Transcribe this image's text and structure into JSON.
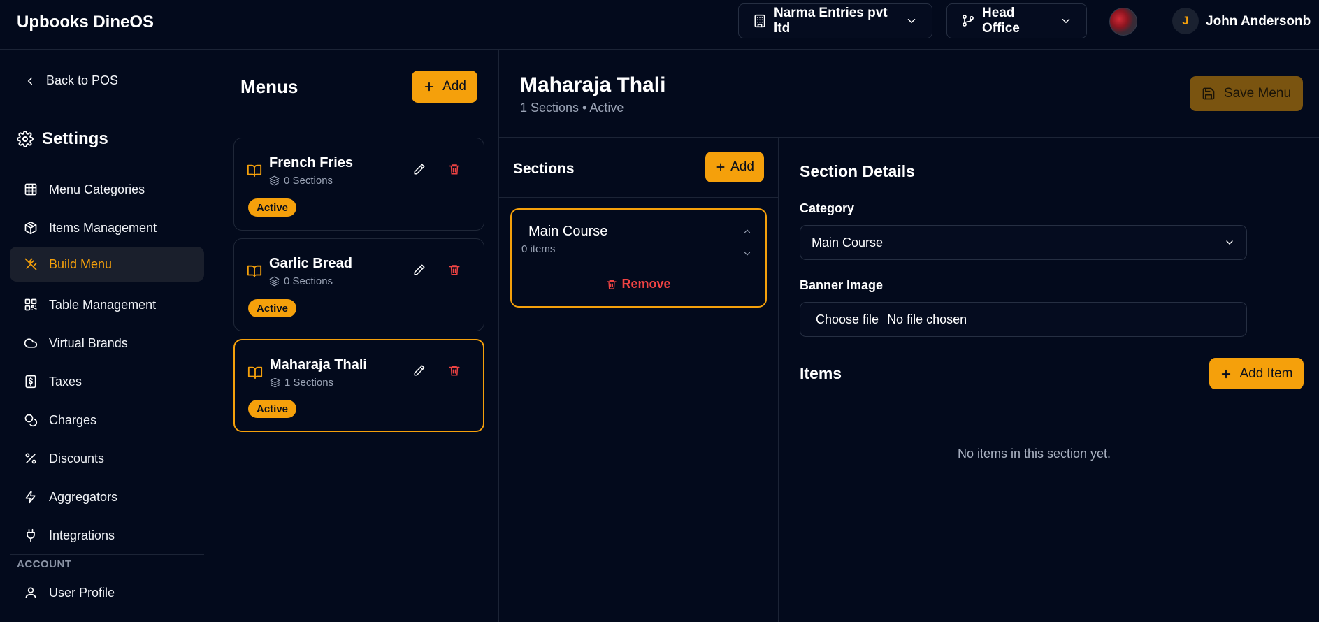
{
  "app": {
    "title": "Upbooks DineOS"
  },
  "header": {
    "org": {
      "label": "Narma Entries pvt ltd",
      "icon": "building-icon"
    },
    "branch": {
      "label": "Head Office",
      "icon": "git-branch-icon"
    },
    "user": {
      "initial": "J",
      "name": "John Andersonb"
    }
  },
  "sidebar": {
    "back_label": "Back to POS",
    "settings_title": "Settings",
    "items": [
      {
        "label": "Menu Categories",
        "icon": "grid-icon"
      },
      {
        "label": "Items Management",
        "icon": "package-icon"
      },
      {
        "label": "Build Menu",
        "icon": "utensils-icon",
        "active": true
      },
      {
        "label": "Table Management",
        "icon": "qr-code-icon"
      },
      {
        "label": "Virtual Brands",
        "icon": "cloud-icon"
      },
      {
        "label": "Taxes",
        "icon": "receipt-dollar-icon"
      },
      {
        "label": "Charges",
        "icon": "coins-icon"
      },
      {
        "label": "Discounts",
        "icon": "percent-icon"
      },
      {
        "label": "Aggregators",
        "icon": "zap-icon"
      },
      {
        "label": "Integrations",
        "icon": "plug-icon"
      }
    ],
    "account_label": "ACCOUNT",
    "account_items": [
      {
        "label": "User Profile",
        "icon": "user-icon"
      }
    ]
  },
  "menus": {
    "title": "Menus",
    "add_label": "Add",
    "items": [
      {
        "name": "French Fries",
        "sections": "0 Sections",
        "status": "Active"
      },
      {
        "name": "Garlic Bread",
        "sections": "0 Sections",
        "status": "Active"
      },
      {
        "name": "Maharaja Thali",
        "sections": "1 Sections",
        "status": "Active",
        "selected": true
      }
    ]
  },
  "editor": {
    "title": "Maharaja Thali",
    "subtitle": "1 Sections • Active",
    "save_label": "Save Menu"
  },
  "sections": {
    "title": "Sections",
    "add_label": "Add",
    "items": [
      {
        "name": "Main Course",
        "count": "0 items",
        "remove_label": "Remove"
      }
    ]
  },
  "details": {
    "title": "Section Details",
    "category_label": "Category",
    "category_value": "Main Course",
    "banner_label": "Banner Image",
    "file_button": "Choose file",
    "file_status": "No file chosen",
    "items_title": "Items",
    "add_item_label": "Add Item",
    "empty_text": "No items in this section yet."
  },
  "colors": {
    "accent": "#f5a00b",
    "danger": "#ef4343",
    "background": "#030a1c"
  }
}
